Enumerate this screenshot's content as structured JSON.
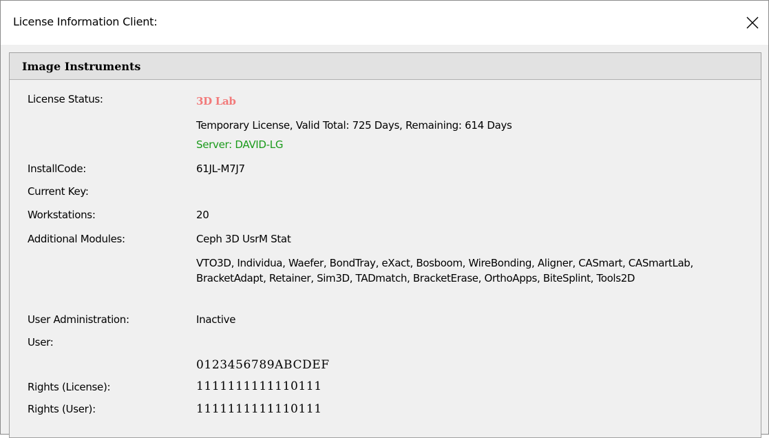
{
  "window": {
    "title": "License Information Client:",
    "close_icon": "close-icon"
  },
  "panel": {
    "header": "Image Instruments",
    "rows": {
      "license_status": {
        "label": "License Status:",
        "name": "3D Lab",
        "detail": "Temporary License, Valid  Total: 725 Days, Remaining: 614 Days",
        "server": "Server: DAVID-LG"
      },
      "install_code": {
        "label": "InstallCode:",
        "value": "61JL-M7J7"
      },
      "current_key": {
        "label": "Current Key:",
        "value": ""
      },
      "workstations": {
        "label": "Workstations:",
        "value": "20"
      },
      "additional_modules": {
        "label": "Additional Modules:",
        "value": "Ceph 3D UsrM Stat",
        "list": "VTO3D, Individua, Waefer, BondTray, eXact, Bosboom, WireBonding, Aligner, CASmart, CASmartLab, BracketAdapt, Retainer, Sim3D, TADmatch, BracketErase, OrthoApps, BiteSplint, Tools2D"
      },
      "user_administration": {
        "label": "User Administration:",
        "value": "Inactive"
      },
      "user": {
        "label": "User:",
        "value": ""
      },
      "rights_header": "0123456789ABCDEF",
      "rights_license": {
        "label": "Rights (License):",
        "value": "1111111111110111"
      },
      "rights_user": {
        "label": "Rights (User):",
        "value": "1111111111110111"
      }
    }
  },
  "colors": {
    "license_name": "#f27a7a",
    "server": "#1a9a1a",
    "window_bg": "#f0f0f0",
    "header_bg": "#e2e2e2"
  }
}
